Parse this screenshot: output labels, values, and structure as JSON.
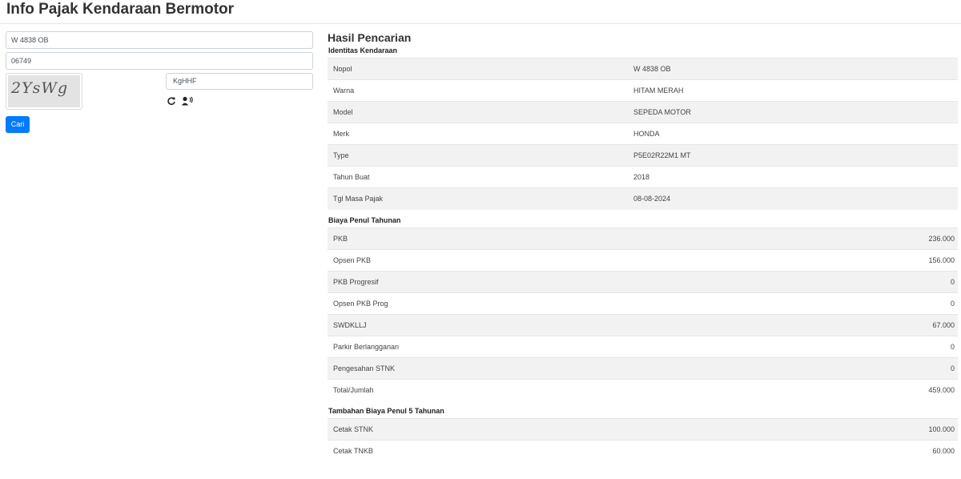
{
  "page": {
    "title": "Info Pajak Kendaraan Bermotor"
  },
  "form": {
    "nopol_value": "W 4838 OB",
    "code_value": "06749",
    "captcha_image_text": "2YsWg",
    "captcha_input_value": "KgHHF",
    "refresh_icon": "refresh-icon",
    "audio_icon": "audio-captcha-icon",
    "submit_label": "Cari",
    "accent_color": "#007bff"
  },
  "results": {
    "title": "Hasil Pencarian",
    "identitas": {
      "heading": "Identitas Kendaraan",
      "rows": [
        {
          "label": "Nopol",
          "value": "W 4838 OB"
        },
        {
          "label": "Warna",
          "value": "HITAM MERAH"
        },
        {
          "label": "Model",
          "value": "SEPEDA MOTOR"
        },
        {
          "label": "Merk",
          "value": "HONDA"
        },
        {
          "label": "Type",
          "value": "P5E02R22M1 MT"
        },
        {
          "label": "Tahun Buat",
          "value": "2018"
        },
        {
          "label": "Tgl Masa Pajak",
          "value": "08-08-2024"
        }
      ]
    },
    "biaya_tahunan": {
      "heading": "Biaya Penul Tahunan",
      "rows": [
        {
          "label": "PKB",
          "value": "236.000"
        },
        {
          "label": "Opsen PKB",
          "value": "156.000"
        },
        {
          "label": "PKB Progresif",
          "value": "0"
        },
        {
          "label": "Opsen PKB Prog",
          "value": "0"
        },
        {
          "label": "SWDKLLJ",
          "value": "67.000"
        },
        {
          "label": "Parkir Berlangganan",
          "value": "0"
        },
        {
          "label": "Pengesahan STNK",
          "value": "0"
        },
        {
          "label": "Total/Jumlah",
          "value": "459.000"
        }
      ]
    },
    "biaya_5_tahunan": {
      "heading": "Tambahan Biaya Penul 5 Tahunan",
      "rows": [
        {
          "label": "Cetak STNK",
          "value": "100.000"
        },
        {
          "label": "Cetak TNKB",
          "value": "60.000"
        }
      ]
    }
  }
}
